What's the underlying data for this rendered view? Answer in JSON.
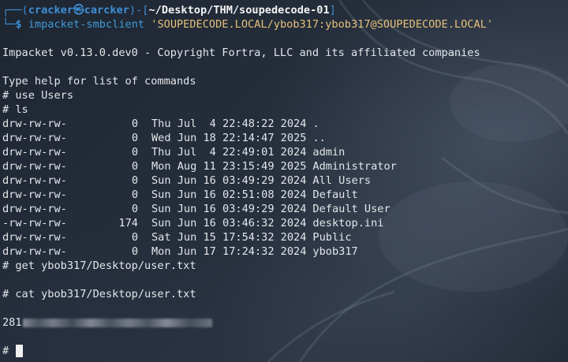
{
  "prompt": {
    "frame_top": "┌──(",
    "user_host": "cracker㉿carcker",
    "mid": ")-[",
    "path": "~/Desktop/THM/soupedecode-01",
    "end": "]",
    "frame_bottom": "└─",
    "dollar": "$ ",
    "command": "impacket-smbclient",
    "argument": "'SOUPEDECODE.LOCAL/ybob317:ybob317@SOUPEDECODE.LOCAL'"
  },
  "banner": "Impacket v0.13.0.dev0 - Copyright Fortra, LLC and its affiliated companies",
  "help_text": "Type help for list of commands",
  "commands": {
    "use": "# use Users",
    "ls": "# ls",
    "get": "# get ybob317/Desktop/user.txt",
    "cat": "# cat ybob317/Desktop/user.txt"
  },
  "listing": [
    {
      "perm": "drw-rw-rw-",
      "size": "0",
      "date": "Thu Jul  4 22:48:22 2024",
      "name": "."
    },
    {
      "perm": "drw-rw-rw-",
      "size": "0",
      "date": "Wed Jun 18 22:14:47 2025",
      "name": ".."
    },
    {
      "perm": "drw-rw-rw-",
      "size": "0",
      "date": "Thu Jul  4 22:49:01 2024",
      "name": "admin"
    },
    {
      "perm": "drw-rw-rw-",
      "size": "0",
      "date": "Mon Aug 11 23:15:49 2025",
      "name": "Administrator"
    },
    {
      "perm": "drw-rw-rw-",
      "size": "0",
      "date": "Sun Jun 16 03:49:29 2024",
      "name": "All Users"
    },
    {
      "perm": "drw-rw-rw-",
      "size": "0",
      "date": "Sun Jun 16 02:51:08 2024",
      "name": "Default"
    },
    {
      "perm": "drw-rw-rw-",
      "size": "0",
      "date": "Sun Jun 16 03:49:29 2024",
      "name": "Default User"
    },
    {
      "perm": "-rw-rw-rw-",
      "size": "174",
      "date": "Sun Jun 16 03:46:32 2024",
      "name": "desktop.ini"
    },
    {
      "perm": "drw-rw-rw-",
      "size": "0",
      "date": "Sat Jun 15 17:54:32 2024",
      "name": "Public"
    },
    {
      "perm": "drw-rw-rw-",
      "size": "0",
      "date": "Mon Jun 17 17:24:32 2024",
      "name": "ybob317"
    }
  ],
  "flag_prefix": "281",
  "final_prompt": "# ",
  "colors": {
    "prompt_blue": "#3d8fd6",
    "argument_yellow": "#e5c07b",
    "text": "#e4e6ea",
    "background": "#222a36"
  }
}
